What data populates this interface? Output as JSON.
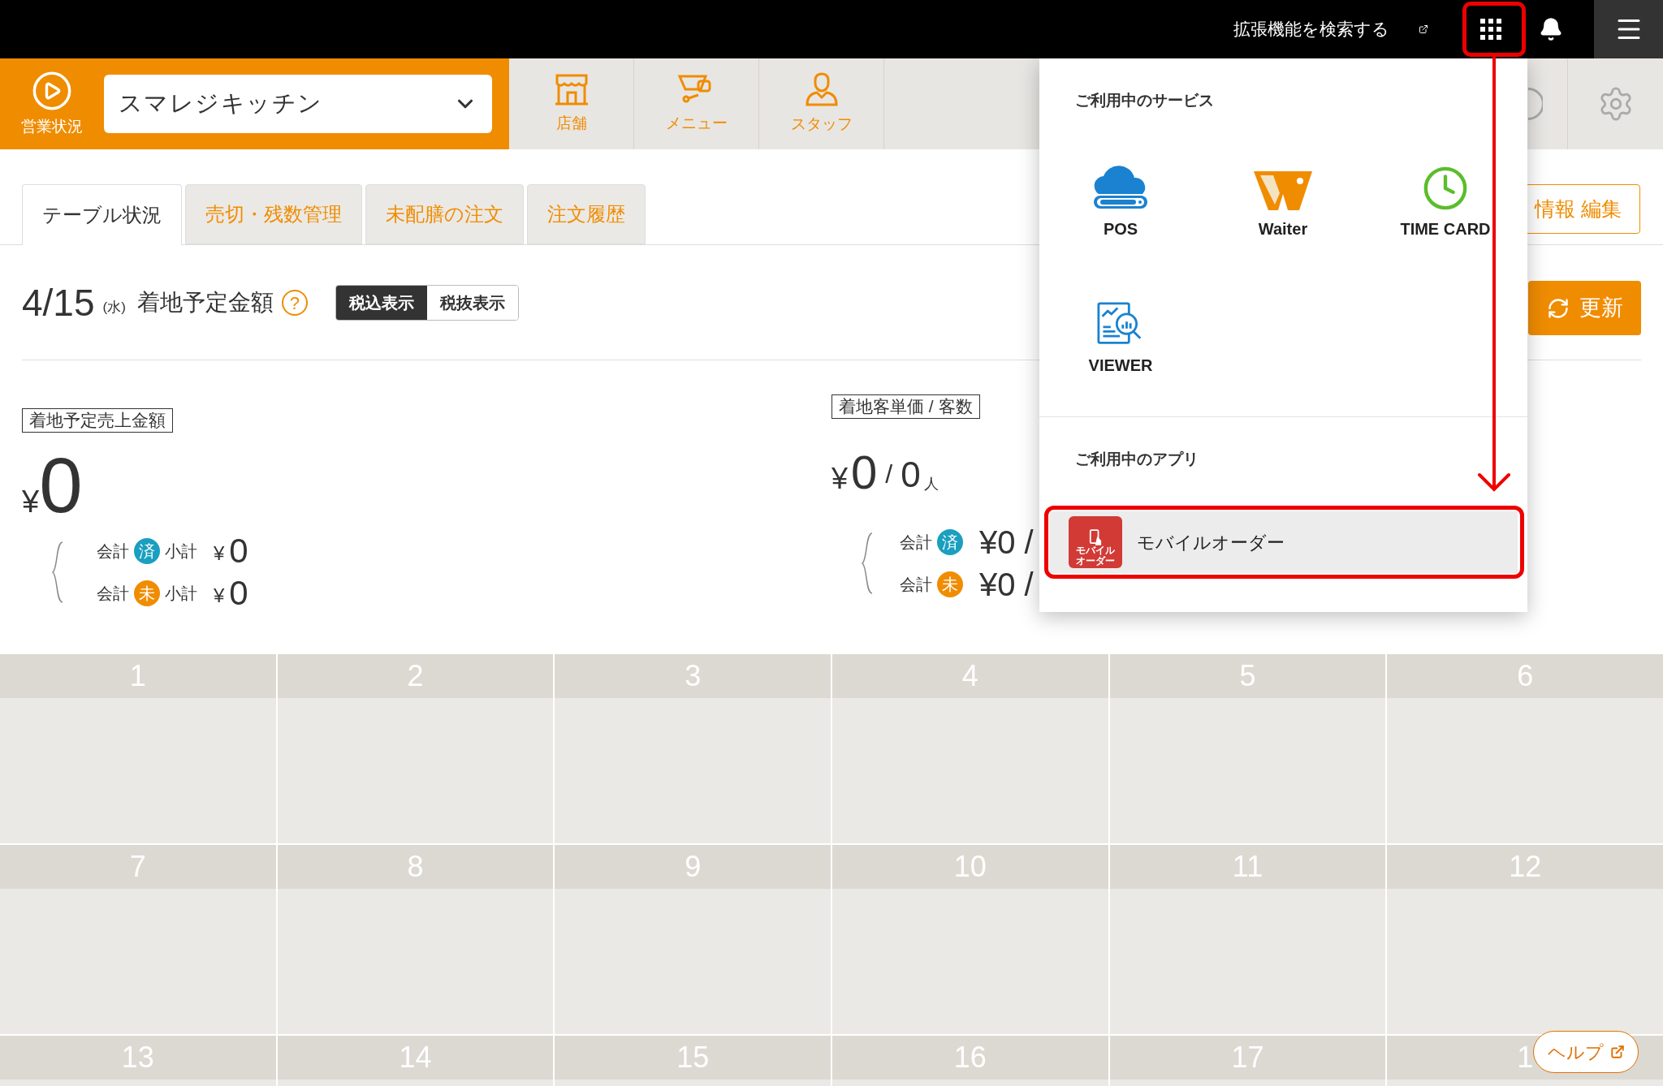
{
  "top_bar": {
    "search_link": "拡張機能を検索する"
  },
  "header": {
    "status_label": "営業状況",
    "store_select": "スマレジキッチン",
    "nav": [
      {
        "kind": "store",
        "label": "店舗"
      },
      {
        "kind": "menu",
        "label": "メニュー"
      },
      {
        "kind": "staff",
        "label": "スタッフ"
      }
    ]
  },
  "tabs": [
    {
      "label": "テーブル状況",
      "selected": true
    },
    {
      "label": "売切・残数管理",
      "selected": false
    },
    {
      "label": "未配膳の注文",
      "selected": false
    },
    {
      "label": "注文履歴",
      "selected": false
    }
  ],
  "edit_button": "情報 編集",
  "refresh_button": "更新",
  "summary": {
    "date": "4/15",
    "weekday": "(水)",
    "title": "着地予定金額",
    "help_mark": "?",
    "tax_toggle": [
      {
        "label": "税込表示",
        "selected": true
      },
      {
        "label": "税抜表示",
        "selected": false
      }
    ]
  },
  "sales": {
    "label": "着地予定売上金額",
    "currency": "¥",
    "amount": "0",
    "rows": [
      {
        "account": "会計",
        "status": "済",
        "color": "#1a9fc0",
        "subtotal_label": "小計",
        "currency": "¥",
        "amount": "0"
      },
      {
        "account": "会計",
        "status": "未",
        "color": "#f08c00",
        "subtotal_label": "小計",
        "currency": "¥",
        "amount": "0"
      }
    ]
  },
  "per_customer": {
    "label": "着地客単価 / 客数",
    "currency": "¥",
    "amount": "0",
    "separator": "/",
    "count": "0",
    "unit": "人",
    "rows": [
      {
        "account": "会計",
        "status": "済",
        "color": "#1a9fc0",
        "value": "¥0 /"
      },
      {
        "account": "会計",
        "status": "未",
        "color": "#f08c00",
        "value": "¥0 /"
      }
    ]
  },
  "calendar": {
    "days": [
      "1",
      "2",
      "3",
      "4",
      "5",
      "6",
      "7",
      "8",
      "9",
      "10",
      "11",
      "12",
      "13",
      "14",
      "15",
      "16",
      "17",
      "1"
    ]
  },
  "services_menu": {
    "services_heading": "ご利用中のサービス",
    "services": [
      {
        "kind": "pos",
        "label": "POS"
      },
      {
        "kind": "waiter",
        "label": "Waiter"
      },
      {
        "kind": "timecard",
        "label": "TIME CARD"
      },
      {
        "kind": "viewer",
        "label": "VIEWER"
      }
    ],
    "apps_heading": "ご利用中のアプリ",
    "apps": [
      {
        "label": "モバイルオーダー",
        "icon_label": [
          "モバイル",
          "オーダー"
        ],
        "selected": true
      }
    ]
  },
  "help_button": "ヘルプ"
}
